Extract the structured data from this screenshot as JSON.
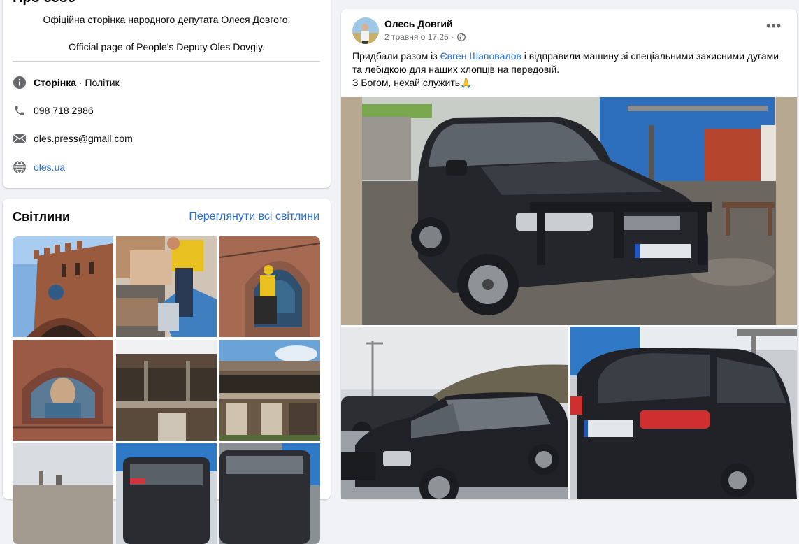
{
  "about": {
    "heading": "Про себе",
    "description_ua": "Офіційна сторінка народного депутата Олеся Довгого.",
    "description_en": "Official page of People's Deputy Oles Dovgiy.",
    "page_type_label": "Сторінка",
    "page_type_sep": " · ",
    "page_category": "Політик",
    "phone": "098 718 2986",
    "email": "oles.press@gmail.com",
    "website": "oles.ua"
  },
  "photos": {
    "title": "Світлини",
    "see_all": "Переглянути всі світлини"
  },
  "post": {
    "author": "Олесь Довгий",
    "timestamp": "2 травня о 17:25",
    "dot": "·",
    "text_before_tag": "Придбали разом із ",
    "tagged_person": "Євген Шаповалов",
    "text_after_tag": " і відправили машину зі спеціальними захисними дугами та лебідкою для наших хлопців на передовій.",
    "text_line2": "З Богом, нехай служить🙏",
    "more_menu": "•••"
  },
  "colors": {
    "link": "#216fdb",
    "secondary_text": "#65676b",
    "background": "#f0f2f5"
  }
}
